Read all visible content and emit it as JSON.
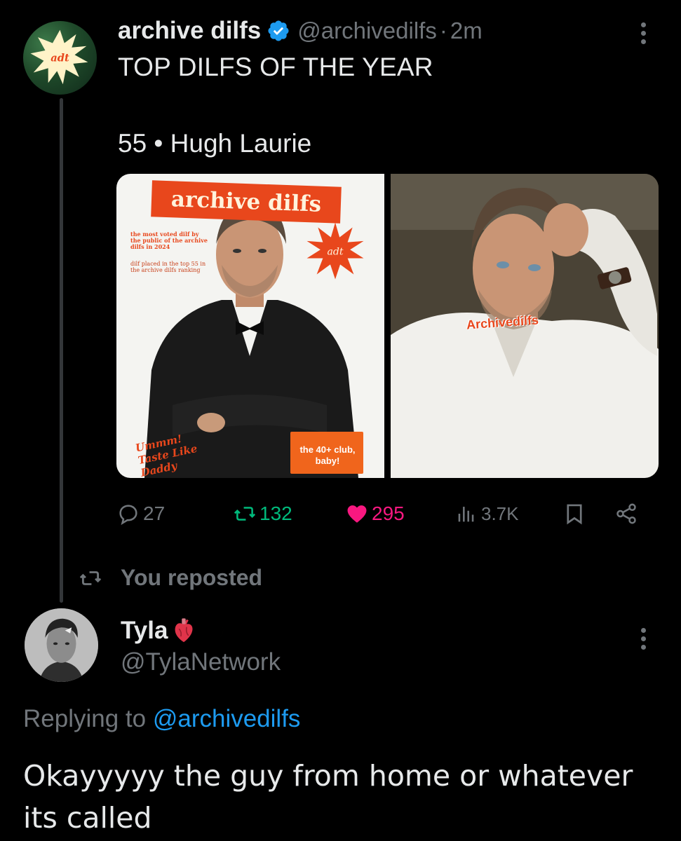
{
  "post": {
    "display_name": "archive dilfs",
    "handle": "@archivedilfs",
    "separator": "·",
    "time": "2m",
    "title": "TOP DILFS OF THE YEAR",
    "subtitle": "55 • Hugh Laurie",
    "avatar_logo": "adt",
    "media": {
      "left": {
        "ribbon": "archive dilfs",
        "badge": "adt",
        "blurb_1": "the most voted dilf by the public of the archive dilfs in 2024",
        "blurb_2": "dilf placed in the top 55 in the archive dilfs ranking",
        "script": "Ummm! Taste Like Daddy",
        "box": "the 40+ club, baby!"
      },
      "right": {
        "watermark": "Archivedilfs"
      }
    },
    "actions": {
      "replies": "27",
      "reposts": "132",
      "likes": "295",
      "views": "3.7K"
    }
  },
  "repost_notice": "You reposted",
  "reply": {
    "display_name": "Tyla",
    "handle": "@TylaNetwork",
    "replying_prefix": "Replying to ",
    "replying_to": "@archivedilfs",
    "body": "Okayyyyy the guy from home or whatever its called"
  },
  "colors": {
    "background": "#000000",
    "text": "#e7e9ea",
    "muted": "#71767b",
    "link": "#1d9bf0",
    "repost_green": "#00ba7c",
    "like_pink": "#f91880",
    "verified_blue": "#1d9bf0",
    "brand_orange": "#e8471c"
  },
  "icons": [
    "more-icon",
    "verified-icon",
    "reply-icon",
    "repost-icon",
    "like-icon",
    "views-icon",
    "bookmark-icon",
    "share-icon"
  ]
}
